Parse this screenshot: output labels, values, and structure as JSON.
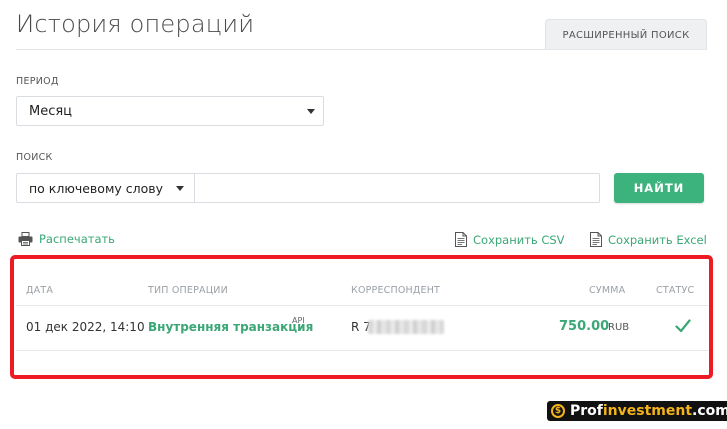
{
  "page": {
    "title": "История операций",
    "advanced_search_label": "РАСШИРЕННЫЙ ПОИСК"
  },
  "filters": {
    "period_label": "ПЕРИОД",
    "period_value": "Месяц",
    "search_label": "ПОИСК",
    "search_type_value": "по ключевому слову",
    "search_value": "",
    "search_placeholder": "",
    "find_button_label": "НАЙТИ"
  },
  "actions": {
    "print_label": "Распечатать",
    "csv_label": "Сохранить CSV",
    "excel_label": "Сохранить Excel"
  },
  "table": {
    "columns": [
      "ДАТА",
      "ТИП ОПЕРАЦИИ",
      "КОРРЕСПОНДЕНТ",
      "СУММА",
      "СТАТУС"
    ],
    "rows": [
      {
        "date": "01 дек 2022, 14:10",
        "type": "Внутренняя транзакция",
        "type_badge": "API",
        "correspondent": "R 7",
        "amount": "750.00",
        "currency": "RUB",
        "status": "success"
      }
    ]
  },
  "watermark": {
    "part1": "Prof",
    "part2": "investment",
    "part3": ".com"
  },
  "colors": {
    "accent_green": "#3cb27d",
    "highlight_red": "#ed1c24"
  }
}
